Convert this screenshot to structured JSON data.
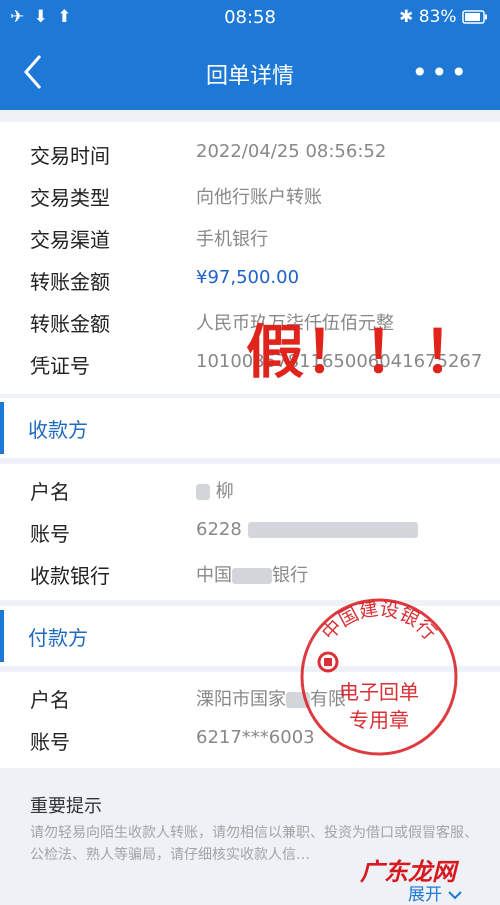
{
  "status_bar": {
    "left_icons": "✈ ⬇ ⬆",
    "time": "08:58",
    "bluetooth": "✱",
    "battery_text": "83%"
  },
  "nav": {
    "title": "回单详情",
    "more": "•••"
  },
  "transaction": [
    {
      "label": "交易时间",
      "value": "2022/04/25  08:56:52"
    },
    {
      "label": "交易类型",
      "value": "向他行账户转账"
    },
    {
      "label": "交易渠道",
      "value": "手机银行"
    },
    {
      "label": "转账金额",
      "value": "¥97,500.00"
    },
    {
      "label": "转账金额",
      "value": "人民币玖万柒仟伍佰元整"
    },
    {
      "label": "凭证号",
      "value": "1010035781165006041675267"
    }
  ],
  "fake_mark": "假！！！",
  "payee": {
    "header": "收款方",
    "rows": [
      {
        "label": "户名",
        "value": "柳"
      },
      {
        "label": "账号",
        "value": "6228"
      },
      {
        "label": "收款银行",
        "value_prefix": "中国",
        "value_suffix": "银行"
      }
    ]
  },
  "payer": {
    "header": "付款方",
    "rows": [
      {
        "label": "户名",
        "value_prefix": "溧阳市国家",
        "value_suffix": "有限"
      },
      {
        "label": "账号",
        "value": "6217***6003"
      }
    ]
  },
  "stamp": {
    "bank_name": "中国建设银行",
    "line1": "电子回单",
    "line2": "专用章"
  },
  "tips": {
    "title": "重要提示",
    "text": "请勿轻易向陌生收款人转账，请勿相信以兼职、投资为借口或假冒客服、公检法、熟人等骗局，请仔细核实收款人信…",
    "expand": "展开"
  },
  "watermark": "广东龙网",
  "colors": {
    "brand_blue": "#1d78d6",
    "amount_blue": "#1e62c8",
    "stamp_red": "#d7191f"
  }
}
